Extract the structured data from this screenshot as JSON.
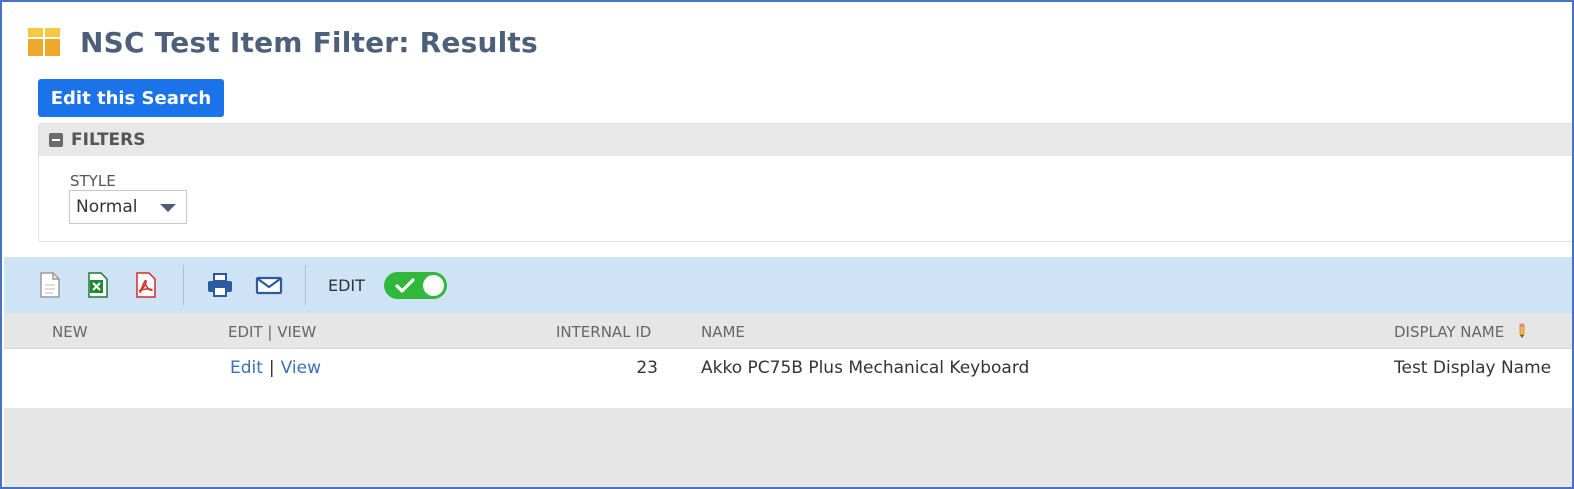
{
  "page": {
    "title": "NSC Test Item Filter: Results",
    "edit_search_label": "Edit this Search"
  },
  "filters": {
    "header": "FILTERS",
    "style_label": "STYLE",
    "style_value": "Normal"
  },
  "toolbar": {
    "icons": [
      "new-document-icon",
      "excel-export-icon",
      "pdf-export-icon",
      "print-icon",
      "email-icon"
    ],
    "edit_label": "EDIT",
    "edit_toggle_on": true,
    "toggle_color": "#2fb83a"
  },
  "table": {
    "columns": {
      "new": "NEW",
      "edit_view": "EDIT | VIEW",
      "internal_id": "INTERNAL ID",
      "name": "NAME",
      "display_name": "DISPLAY NAME"
    },
    "rows": [
      {
        "edit": "Edit",
        "separator": "|",
        "view": "View",
        "internal_id": "23",
        "name": "Akko PC75B Plus Mechanical Keyboard",
        "display_name": "Test Display Name"
      }
    ]
  },
  "colors": {
    "accent": "#1a73e8",
    "toolbar_bg": "#cfe3f7",
    "title_text": "#4d5f79",
    "link": "#3b6fb6"
  }
}
